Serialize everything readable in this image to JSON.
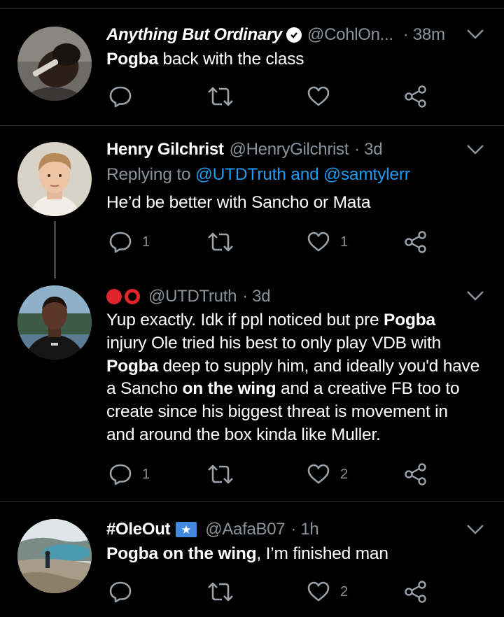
{
  "tweets": [
    {
      "name": "Anything But Ordinary",
      "handle": "@CohlOn...",
      "time": "· 38m",
      "text_parts": [
        {
          "t": "Pogba",
          "b": true
        },
        {
          "t": " back with the class",
          "b": false
        }
      ],
      "replies": "",
      "likes": ""
    },
    {
      "name": "Henry Gilchrist",
      "handle": "@HenryGilchrist",
      "time": "· 3d",
      "replying_prefix": "Replying to",
      "replying_users": "@UTDTruth and @samtylerr",
      "text": "He’d be better with Sancho or Mata",
      "replies": "1",
      "likes": "1"
    },
    {
      "name": "",
      "handle": "@UTDTruth",
      "time": "· 3d",
      "lines": [
        [
          {
            "t": "Yup exactly. Idk if ppl noticed but pre ",
            "b": false
          },
          {
            "t": "Pogba",
            "b": true
          }
        ],
        [
          {
            "t": "injury Ole tried his best to only play VDB with",
            "b": false
          }
        ],
        [
          {
            "t": "Pogba",
            "b": true
          },
          {
            "t": " deep to supply him, and ideally you'd have",
            "b": false
          }
        ],
        [
          {
            "t": "a Sancho ",
            "b": false
          },
          {
            "t": "on the wing",
            "b": true
          },
          {
            "t": " and a creative FB too to",
            "b": false
          }
        ],
        [
          {
            "t": "create since his biggest threat is movement in",
            "b": false
          }
        ],
        [
          {
            "t": "and around the box kinda like Muller.",
            "b": false
          }
        ]
      ],
      "replies": "1",
      "likes": "2"
    },
    {
      "name": "#OleOut",
      "handle": "@AafaB07",
      "time": "· 1h",
      "text_parts": [
        {
          "t": "Pogba on the wing",
          "b": true
        },
        {
          "t": ", I’m finished man",
          "b": false
        }
      ],
      "replies": "",
      "likes": "2"
    }
  ],
  "colors": {
    "background": "#000000",
    "text": "#ffffff",
    "secondary": "#8b9299",
    "link": "#1d9bf0",
    "divider": "#2a2d31",
    "red_circle": "#e0262c"
  },
  "icons": [
    "reply-icon",
    "retweet-icon",
    "like-icon",
    "share-icon",
    "chevron-down-icon",
    "verified-badge-icon",
    "somalia-flag-icon"
  ]
}
